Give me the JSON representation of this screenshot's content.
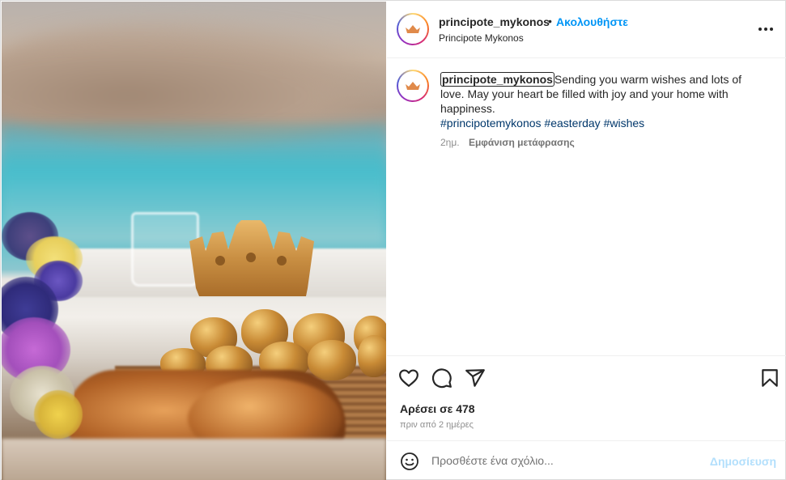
{
  "post": {
    "username": "principote_mykonos",
    "separator": "•",
    "follow_label": "Ακολουθήστε",
    "location": "Principote Mykonos",
    "more_icon": "more-horizontal-icon"
  },
  "caption": {
    "username": "principote_mykonos",
    "text": "Sending you warm wishes and lots of love. May your heart be filled with joy and your home with happiness.",
    "hashtags": [
      "#principotemykonos",
      "#easterday",
      "#wishes"
    ],
    "time_ago": "2ημ.",
    "translate_label": "Εμφάνιση μετάφρασης"
  },
  "actions": {
    "likes_label": "Αρέσει σε 478",
    "date_label": "πριν από 2 ημέρες"
  },
  "comment": {
    "placeholder": "Προσθέστε ένα σχόλιο...",
    "publish_label": "Δημοσίευση"
  },
  "colors": {
    "accent": "#0095f6",
    "hashtag": "#00376b",
    "publish_disabled": "#b2dffc",
    "muted": "#8e8e8e"
  }
}
